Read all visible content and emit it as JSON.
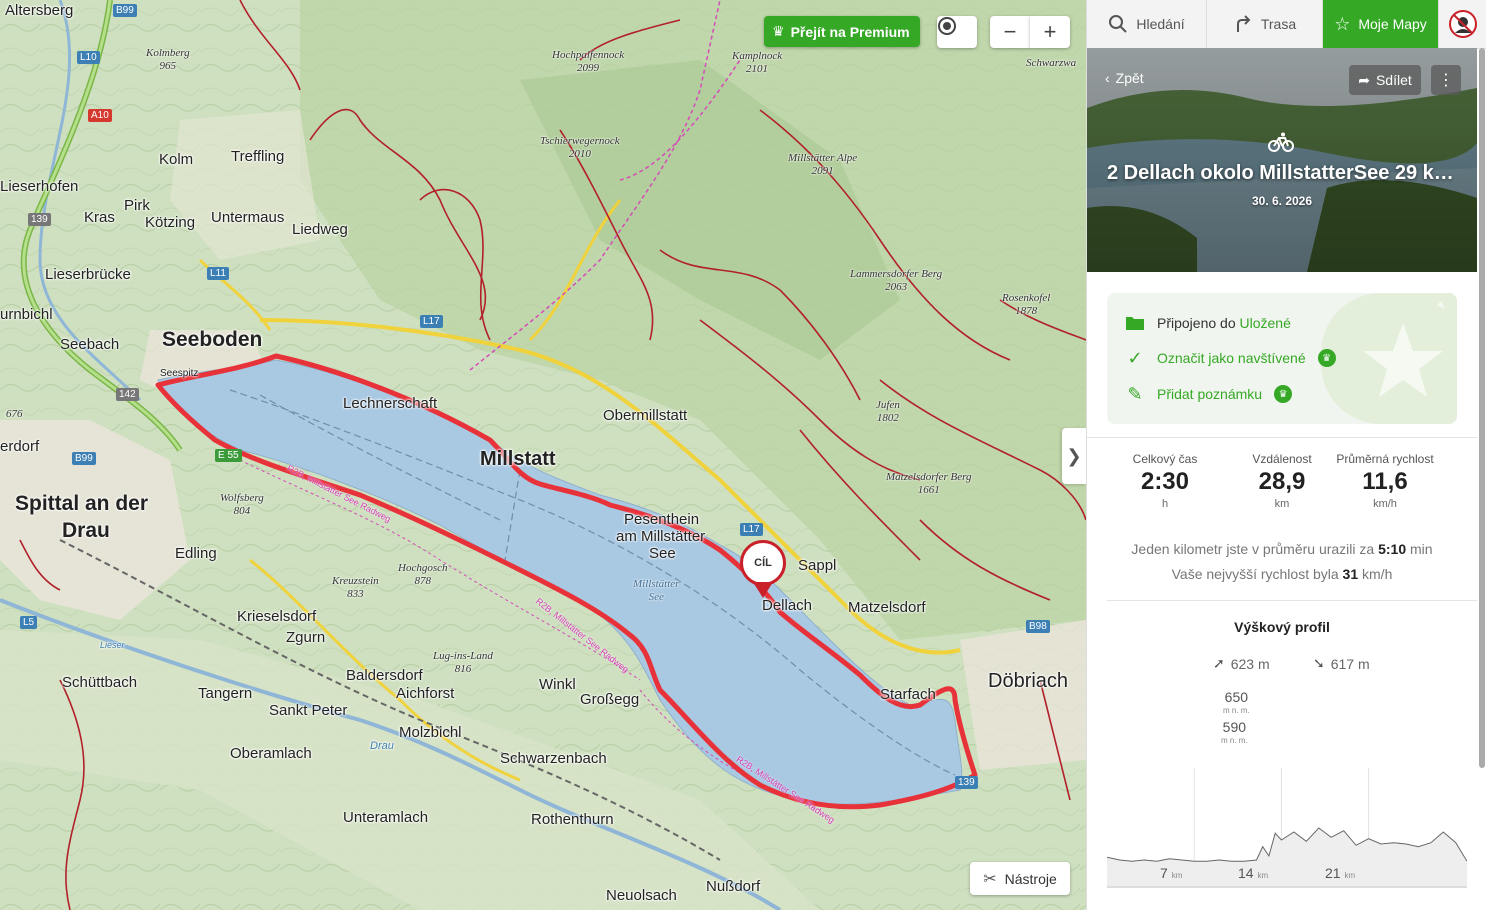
{
  "map": {
    "premium_label": "Přejít na Premium",
    "zoom_out": "−",
    "zoom_in": "+",
    "tools_label": "Nástroje",
    "collapse_arrow": "❯",
    "finish_marker": "CÍL",
    "places": {
      "altersberg": "Altersberg",
      "kolm": "Kolm",
      "treffling": "Treffling",
      "lieserhofen": "Lieserhofen",
      "pirk": "Pirk",
      "kras": "Kras",
      "kotzing": "Kötzing",
      "untermaus": "Untermaus",
      "liedweg": "Liedweg",
      "lieserbrucke": "Lieserbrücke",
      "urnbichl": "urnbichl",
      "seebach": "Seebach",
      "seeboden": "Seeboden",
      "seespitz": "Seespitz",
      "lechnerschaft": "Lechnerschaft",
      "obermillstatt": "Obermillstatt",
      "millstatt": "Millstatt",
      "spittal1": "Spittal an der",
      "spittal2": "Drau",
      "erdorf": "erdorf",
      "edling": "Edling",
      "pesenthein1": "Pesenthein",
      "pesenthein2": "am Millstätter",
      "pesenthein3": "See",
      "sappl": "Sappl",
      "dellach": "Dellach",
      "matzelsdorf": "Matzelsdorf",
      "krieselsdorf": "Krieselsdorf",
      "zgurn": "Zgurn",
      "baldersdorf": "Baldersdorf",
      "aichforst": "Aichforst",
      "schuttbach": "Schüttbach",
      "tangern": "Tangern",
      "sankt_peter": "Sankt Peter",
      "winkl": "Winkl",
      "grossegg": "Großegg",
      "starfach": "Starfach",
      "dobriach": "Döbriach",
      "oberamlach": "Oberamlach",
      "molzbichl": "Molzbichl",
      "schwarzenbach": "Schwarzenbach",
      "unteramlach": "Unteramlach",
      "rothenthurn": "Rothenthurn",
      "neuolsach": "Neuolsach",
      "nussdorf": "Nußdorf",
      "drau_river": "Drau",
      "lieser_river": "Lieser"
    },
    "peaks": {
      "kolmberg": {
        "name": "Kolmberg",
        "ele": "965"
      },
      "hochpalfennock": {
        "name": "Hochpalfennock",
        "ele": "2099"
      },
      "kamplnock": {
        "name": "Kamplnock",
        "ele": "2101"
      },
      "schwarzwand": {
        "name": "Schwarzwa",
        "ele": ""
      },
      "tschierwegernock": {
        "name": "Tschierwegernock",
        "ele": "2010"
      },
      "millstatter_alpe": {
        "name": "Millstätter Alpe",
        "ele": "2091"
      },
      "lammersdorfer": {
        "name": "Lammersdorfer Berg",
        "ele": "2063"
      },
      "rosenkofel": {
        "name": "Rosenkofel",
        "ele": "1878"
      },
      "jufen": {
        "name": "Jufen",
        "ele": "1802"
      },
      "matzelsdorfer": {
        "name": "Matzelsdorfer Berg",
        "ele": "1661"
      },
      "wolfsberg": {
        "name": "Wolfsberg",
        "ele": "804"
      },
      "hochgosch": {
        "name": "Hochgosch",
        "ele": "878"
      },
      "kreuzstein": {
        "name": "Kreuzstein",
        "ele": "833"
      },
      "lug_ins_land": {
        "name": "Lug-ins-Land",
        "ele": "816"
      },
      "n676": {
        "name": "",
        "ele": "676"
      },
      "lake_name1": {
        "name": "Millstätter",
        "ele": "See"
      }
    },
    "roads": [
      "B99",
      "L10",
      "A10",
      "139",
      "L11",
      "L17",
      "142",
      "E 55",
      "B99",
      "L5",
      "L17",
      "B98",
      "139"
    ],
    "route_labels": [
      "R2B, Millstätter See Radweg",
      "R2B, Millstätter See Radweg",
      "R2B, Millstätter See Radweg"
    ]
  },
  "nav": {
    "search": "Hledání",
    "route": "Trasa",
    "my_maps": "Moje Mapy"
  },
  "detail": {
    "back": "Zpět",
    "share": "Sdílet",
    "title": "2 Dellach okolo MillstatterSee 29 k…",
    "date": "30. 6. 2026",
    "connected_prefix": "Připojeno do",
    "connected_folder": "Uložené",
    "mark_visited": "Označit jako navštívené",
    "add_note": "Přidat poznámku",
    "stats": [
      {
        "label": "Celkový čas",
        "value": "2:30",
        "unit": "h"
      },
      {
        "label": "Vzdálenost",
        "value": "28,9",
        "unit": "km"
      },
      {
        "label": "Průměrná rychlost",
        "value": "11,6",
        "unit": "km/h"
      }
    ],
    "pace_prefix": "Jeden kilometr jste v průměru urazili za",
    "pace_value": "5:10",
    "pace_unit": "min",
    "max_prefix": "Vaše nejvyšší rychlost byla",
    "max_value": "31",
    "max_unit": "km/h",
    "profile_title": "Výškový profil",
    "ascent": "623 m",
    "descent": "617 m",
    "elev_max": "650",
    "elev_min": "590",
    "elev_unit": "m n. m.",
    "km_ticks": [
      "7",
      "14",
      "21"
    ],
    "km_unit": "km"
  },
  "colors": {
    "brand_green": "#35a825",
    "route_red": "#e8323a",
    "lake": "#a9c8e2"
  },
  "chart_data": {
    "type": "area",
    "title": "Výškový profil",
    "xlabel": "km",
    "ylabel": "m n. m.",
    "y_ticks": [
      590,
      650
    ],
    "x_ticks": [
      7,
      14,
      21
    ],
    "x": [
      0,
      1,
      2,
      3,
      4,
      5,
      6,
      7,
      8,
      9,
      10,
      11,
      12,
      12.5,
      13,
      13.5,
      14,
      15,
      16,
      17,
      18,
      19,
      20,
      21,
      22,
      23,
      24,
      25,
      26,
      27,
      28,
      28.9
    ],
    "values": [
      593,
      591,
      590,
      591,
      590,
      592,
      591,
      590,
      590,
      591,
      590,
      590,
      591,
      601,
      594,
      611,
      606,
      612,
      605,
      615,
      608,
      613,
      602,
      607,
      603,
      604,
      603,
      601,
      604,
      612,
      604,
      590
    ]
  }
}
